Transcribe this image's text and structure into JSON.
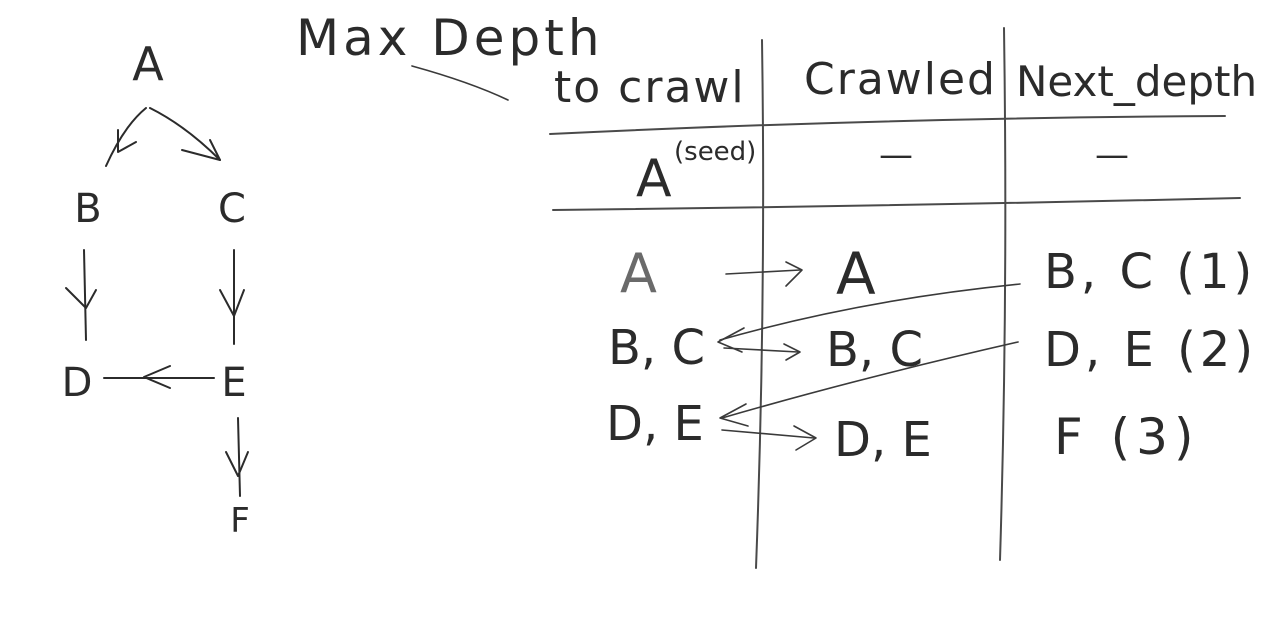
{
  "title": "Max Depth",
  "graph": {
    "nodes": [
      "A",
      "B",
      "C",
      "D",
      "E",
      "F"
    ]
  },
  "table": {
    "headers": [
      "to crawl",
      "Crawled",
      "Next_depth"
    ],
    "seed_row": {
      "to_crawl": "A",
      "seed_label": "(seed)",
      "crawled": "—",
      "next_depth": "—"
    },
    "rows": [
      {
        "to_crawl": "A",
        "crawled": "A",
        "next_depth": "B, C (1)"
      },
      {
        "to_crawl": "B, C",
        "crawled": "B, C",
        "next_depth": "D, E (2)"
      },
      {
        "to_crawl": "D, E",
        "crawled": "D, E",
        "next_depth": "F (3)"
      }
    ]
  }
}
